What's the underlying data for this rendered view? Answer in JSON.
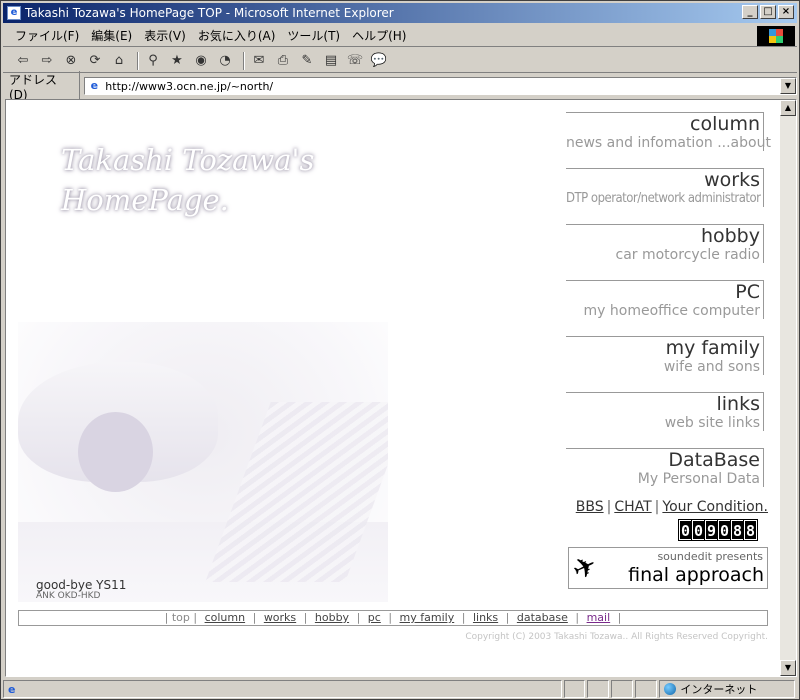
{
  "window": {
    "title": "Takashi Tozawa's HomePage TOP - Microsoft Internet Explorer",
    "buttons": [
      "_",
      "□",
      "×"
    ]
  },
  "menubar": {
    "items": [
      "ファイル(F)",
      "編集(E)",
      "表示(V)",
      "お気に入り(A)",
      "ツール(T)",
      "ヘルプ(H)"
    ]
  },
  "toolbar": {
    "icons": [
      "back-icon",
      "forward-icon",
      "stop-icon",
      "refresh-icon",
      "home-icon",
      "search-icon",
      "favorites-icon",
      "media-icon",
      "history-icon",
      "mail-icon",
      "print-icon",
      "edit-icon",
      "discuss-icon",
      "messenger-icon",
      "research-icon"
    ]
  },
  "addressbar": {
    "label": "アドレス(D)",
    "url": "http://www3.ocn.ne.jp/~north/"
  },
  "site": {
    "logo_line1": "Takashi Tozawa's",
    "logo_line2": "HomePage.",
    "photo_caption": "good-bye YS11",
    "photo_subcaption": "ANK OKD-HKD",
    "nav": [
      {
        "title": "column",
        "subtitle": "news and infomation ...about"
      },
      {
        "title": "works",
        "subtitle": "DTP operator/network administrator"
      },
      {
        "title": "hobby",
        "subtitle": "car motorcycle radio"
      },
      {
        "title": "PC",
        "subtitle": "my homeoffice computer"
      },
      {
        "title": "my family",
        "subtitle": "wife and sons"
      },
      {
        "title": "links",
        "subtitle": "web site links"
      },
      {
        "title": "DataBase",
        "subtitle": "My Personal Data"
      }
    ],
    "links": [
      "BBS",
      "CHAT",
      "Your Condition."
    ],
    "counter": [
      "0",
      "0",
      "9",
      "0",
      "8",
      "8"
    ],
    "banner_pre": "soundedit presents",
    "banner_title": "final approach",
    "bottom_nav": [
      "top",
      "column",
      "works",
      "hobby",
      "pc",
      "my family",
      "links",
      "database",
      "mail"
    ],
    "copyright": "Copyright (C) 2003 Takashi Tozawa.. All Rights Reserved Copyright."
  },
  "statusbar": {
    "zone": "インターネット"
  }
}
